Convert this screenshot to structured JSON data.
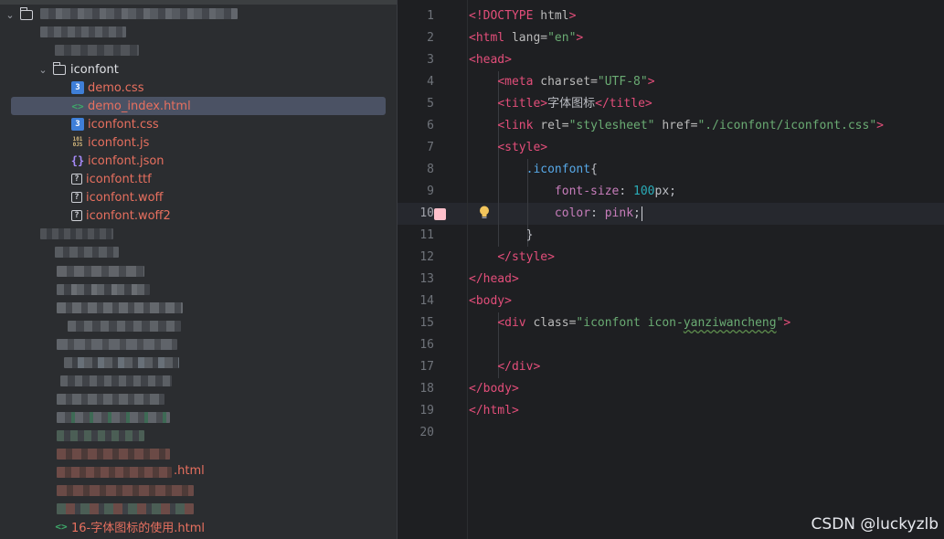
{
  "tree": {
    "folder": "iconfont",
    "files": [
      {
        "name": "demo.css",
        "icon": "css-file-icon",
        "kind": "css"
      },
      {
        "name": "demo_index.html",
        "icon": "html-file-icon",
        "kind": "html",
        "selected": true
      },
      {
        "name": "iconfont.css",
        "icon": "css-file-icon",
        "kind": "css"
      },
      {
        "name": "iconfont.js",
        "icon": "js-file-icon",
        "kind": "js"
      },
      {
        "name": "iconfont.json",
        "icon": "json-file-icon",
        "kind": "json"
      },
      {
        "name": "iconfont.ttf",
        "icon": "unknown-file-icon",
        "kind": "unk"
      },
      {
        "name": "iconfont.woff",
        "icon": "unknown-file-icon",
        "kind": "unk"
      },
      {
        "name": "iconfont.woff2",
        "icon": "unknown-file-icon",
        "kind": "unk"
      }
    ],
    "partial_html_suffix": ".html",
    "last_file": "16-字体图标的使用.html"
  },
  "editor": {
    "line_numbers": [
      "1",
      "2",
      "3",
      "4",
      "5",
      "6",
      "7",
      "8",
      "9",
      "10",
      "11",
      "12",
      "13",
      "14",
      "15",
      "16",
      "17",
      "18",
      "19",
      "20"
    ],
    "active_line": "10",
    "color_swatch": "#ffc0cb",
    "code": {
      "l1_doctype": "<!DOCTYPE",
      "l1_html": "html",
      "l1_close": ">",
      "l2_open": "<html",
      "l2_attr": "lang=",
      "l2_val": "\"en\"",
      "l3_head": "<head>",
      "l4_meta": "<meta",
      "l4_attr": "charset=",
      "l4_val": "\"UTF-8\"",
      "l5_title_open": "<title>",
      "l5_text": "字体图标",
      "l5_title_close": "</title>",
      "l6_link": "<link",
      "l6_rel": "rel=",
      "l6_rel_val": "\"stylesheet\"",
      "l6_href": "href=",
      "l6_href_val": "\"./iconfont/iconfont.css\"",
      "l7_style": "<style>",
      "l8_selector": ".iconfont",
      "l8_brace": "{",
      "l9_prop": "font-size",
      "l9_num": "100",
      "l9_unit": "px;",
      "l10_prop": "color",
      "l10_val": "pink",
      "l10_semi": ";",
      "l11_brace": "}",
      "l12_style_close": "</style>",
      "l13_head_close": "</head>",
      "l14_body": "<body>",
      "l15_div": "<div",
      "l15_attr": "class=",
      "l15_val_a": "\"iconfont icon-",
      "l15_val_b": "yanziwancheng",
      "l15_val_c": "\"",
      "l17_div_close": "</div>",
      "l18_body_close": "</body>",
      "l19_html_close": "</html>"
    }
  },
  "watermark": "CSDN @luckyzlb"
}
